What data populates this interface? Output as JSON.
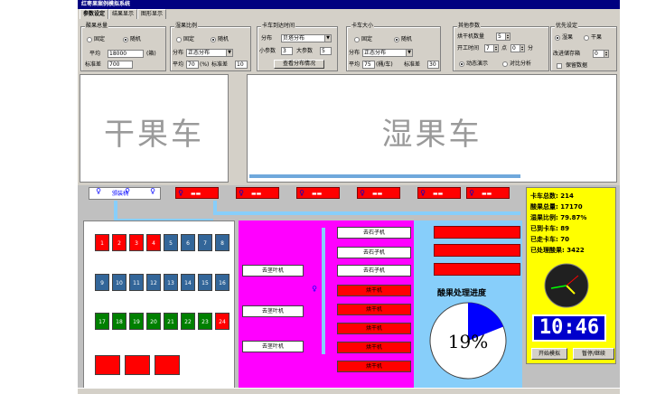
{
  "window": {
    "title": "红枣果案例模拟系统"
  },
  "tabs": [
    "参数设定",
    "结果显示",
    "图形显示"
  ],
  "groups": {
    "total": {
      "title": "酸果总量",
      "fixed": "固定",
      "random": "随机",
      "mean_label": "平均",
      "mean_value": "18000",
      "mean_unit": "(箱)",
      "std_label": "标准差",
      "std_value": "700"
    },
    "wet_ratio": {
      "title": "湿果比例",
      "fixed": "固定",
      "random": "随机",
      "dist_label": "分布",
      "dist_value": "正态分布",
      "mean_label": "平均",
      "mean_value": "70",
      "mean_unit": "(%)",
      "std_label": "标准差",
      "std_value": "10"
    },
    "arrival": {
      "title": "卡车到达时间",
      "dist_label": "分布",
      "dist_value": "贝塔分布",
      "small_label": "小参数",
      "small_value": "3",
      "big_label": "大参数",
      "big_value": "5",
      "view_button": "查看分布情况"
    },
    "truck_size": {
      "title": "卡车大小",
      "fixed": "固定",
      "random": "随机",
      "dist_label": "分布",
      "dist_value": "正态分布",
      "mean_label": "平均",
      "mean_value": "75",
      "mean_unit": "(桶/车)",
      "std_label": "标准差",
      "std_value": "30"
    },
    "other": {
      "title": "其他参数",
      "dryer_label": "烘干机数量",
      "dryer_value": "5",
      "start_label": "开工时间",
      "start_hour": "7",
      "hour_unit": "点",
      "start_min": "0",
      "min_unit": "分",
      "dynamic": "动态演示",
      "compare": "对比分析"
    },
    "priority": {
      "title": "优先设定",
      "wet": "湿果",
      "dry": "干果",
      "store_label": "改进储存箱",
      "store_value": "0",
      "keep_label": "保留数据"
    }
  },
  "canvas": {
    "dry": "干果车",
    "wet": "湿果车"
  },
  "sim": {
    "weigh_label": "颁装机",
    "slots": [
      {
        "n": "1",
        "c": "red"
      },
      {
        "n": "2",
        "c": "red"
      },
      {
        "n": "3",
        "c": "red"
      },
      {
        "n": "4",
        "c": "red"
      },
      {
        "n": "5",
        "c": "blue"
      },
      {
        "n": "6",
        "c": "blue"
      },
      {
        "n": "7",
        "c": "blue"
      },
      {
        "n": "8",
        "c": "blue"
      },
      {
        "n": "9",
        "c": "blue"
      },
      {
        "n": "10",
        "c": "blue"
      },
      {
        "n": "11",
        "c": "blue"
      },
      {
        "n": "12",
        "c": "blue"
      },
      {
        "n": "13",
        "c": "blue"
      },
      {
        "n": "14",
        "c": "blue"
      },
      {
        "n": "15",
        "c": "blue"
      },
      {
        "n": "16",
        "c": "blue"
      },
      {
        "n": "17",
        "c": "green"
      },
      {
        "n": "18",
        "c": "green"
      },
      {
        "n": "19",
        "c": "green"
      },
      {
        "n": "20",
        "c": "green"
      },
      {
        "n": "21",
        "c": "green"
      },
      {
        "n": "22",
        "c": "green"
      },
      {
        "n": "23",
        "c": "green"
      },
      {
        "n": "24",
        "c": "red"
      },
      {
        "n": "",
        "c": "red"
      },
      {
        "n": "",
        "c": "red"
      },
      {
        "n": "",
        "c": "red"
      }
    ],
    "stem_label": "去茎叶机",
    "stone_label": "去石子机",
    "dryer_label": "烘干机",
    "progress_title": "酸果处理进度",
    "progress_value": "19%",
    "progress_fraction": 0.19
  },
  "stats": {
    "trucks_total": "卡车总数: 214",
    "fruit_total": "酸果总量: 17170",
    "wet_ratio": "湿果比例: 79.87%",
    "arrived": "已到卡车: 89",
    "left": "已走卡车: 70",
    "processed": "已处理酸果: 3422"
  },
  "clock": {
    "time": "10:46"
  },
  "buttons": {
    "start": "开始模拟",
    "pause": "暂停/继续"
  },
  "colors": {
    "title_bar": "#000080",
    "truck": "#ff0000",
    "sim_bg": "#c0c0c0",
    "stats_bg": "#ffff00",
    "magenta": "#ff00ff",
    "progress": "#0000ff"
  }
}
